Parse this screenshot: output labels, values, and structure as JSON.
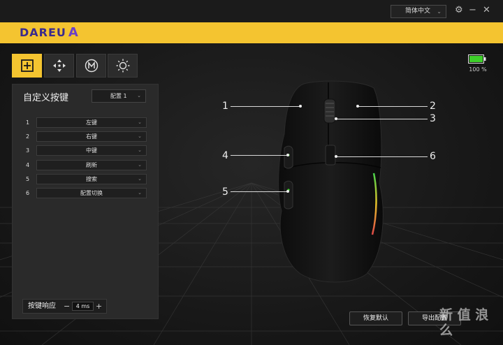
{
  "titlebar": {
    "language": "简体中文",
    "settings_icon": "gear-icon",
    "min_icon": "minimize-icon",
    "close_icon": "close-icon"
  },
  "brand": {
    "logo_text": "DAREU",
    "logo_mark": "A"
  },
  "tabs": [
    {
      "id": "custom-keys",
      "icon": "plus-square-icon",
      "active": true
    },
    {
      "id": "dpi",
      "icon": "move-arrows-icon",
      "active": false
    },
    {
      "id": "macro",
      "icon": "macro-m-icon",
      "active": false
    },
    {
      "id": "lighting",
      "icon": "sun-icon",
      "active": false
    }
  ],
  "battery": {
    "percent_label": "100 %",
    "level": 1.0,
    "color": "#3ecf2a"
  },
  "panel": {
    "title": "自定义按键",
    "profile": "配置 1",
    "keys": [
      {
        "num": "1",
        "value": "左键"
      },
      {
        "num": "2",
        "value": "右键"
      },
      {
        "num": "3",
        "value": "中键"
      },
      {
        "num": "4",
        "value": "刷新"
      },
      {
        "num": "5",
        "value": "搜索"
      },
      {
        "num": "6",
        "value": "配置切换"
      }
    ],
    "response": {
      "label": "按键响应",
      "minus": "−",
      "value": "4 ms",
      "plus": "+"
    }
  },
  "callouts": [
    "1",
    "2",
    "3",
    "4",
    "5",
    "6"
  ],
  "buttons": {
    "restore": "恢复默认",
    "export": "导出配置"
  },
  "watermark": "新 值 浪 么",
  "colors": {
    "accent": "#f4c430",
    "logo": "#3a2a8c"
  }
}
